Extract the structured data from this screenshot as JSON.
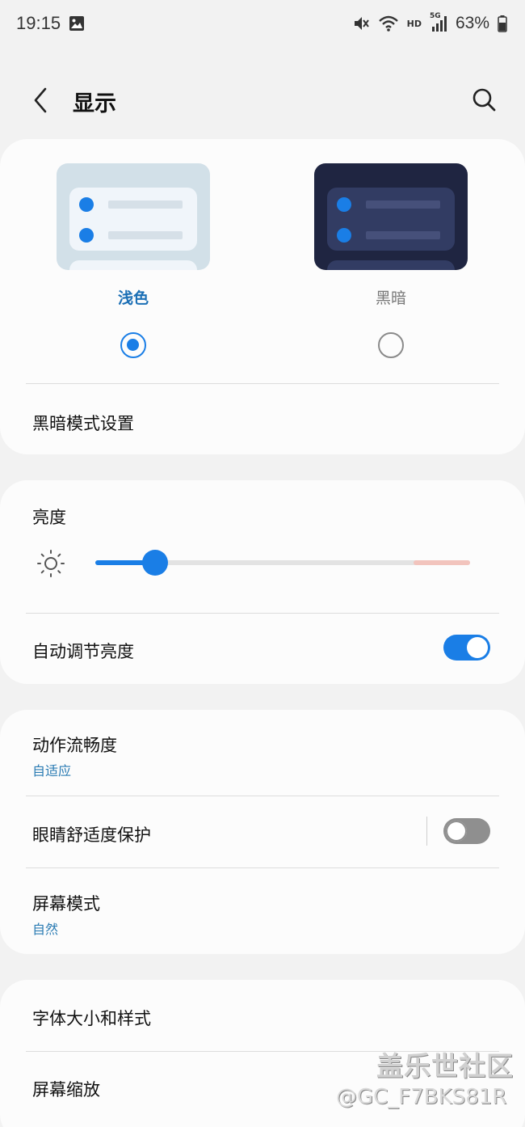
{
  "status_bar": {
    "time": "19:15",
    "battery": "63%",
    "network_hd": "HD",
    "network_5g": "5G"
  },
  "header": {
    "title": "显示"
  },
  "theme_card": {
    "light_label": "浅色",
    "dark_label": "黑暗",
    "selected": "light",
    "dark_mode_settings": "黑暗模式设置"
  },
  "brightness_card": {
    "title": "亮度",
    "brightness_level": 0.16,
    "auto_brightness_label": "自动调节亮度",
    "auto_brightness_on": true
  },
  "display_card": {
    "motion_label": "动作流畅度",
    "motion_value": "自适应",
    "eye_comfort_label": "眼睛舒适度保护",
    "eye_comfort_on": false,
    "screen_mode_label": "屏幕模式",
    "screen_mode_value": "自然"
  },
  "font_card": {
    "font_label": "字体大小和样式",
    "zoom_label": "屏幕缩放"
  },
  "watermark": {
    "line1": "盖乐世社区",
    "line2": "@GC_F7BKS81R"
  },
  "colors": {
    "accent": "#1a7ee6",
    "sub_text": "#2a7bb3",
    "light_label": "#1b6fb5",
    "dark_label": "#777777"
  },
  "icons": {
    "back": "chevron-left-icon",
    "search": "search-icon",
    "brightness": "sun-icon",
    "gallery": "image-icon",
    "mute": "mute-icon",
    "wifi": "wifi-icon",
    "signal": "signal-icon",
    "battery": "battery-icon"
  }
}
